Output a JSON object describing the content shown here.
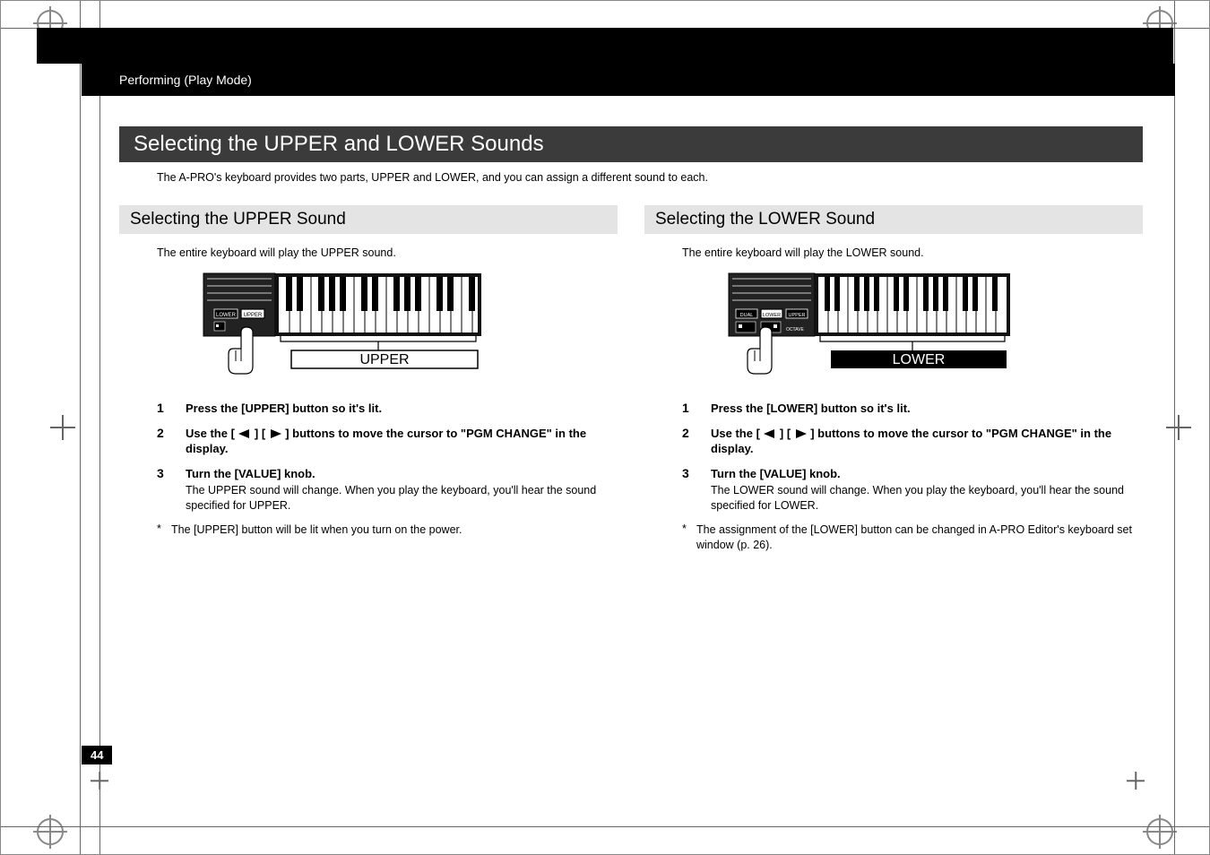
{
  "header": {
    "breadcrumb": "Performing (Play Mode)"
  },
  "title": "Selecting the UPPER and LOWER Sounds",
  "intro": "The A-PRO's keyboard provides two parts, UPPER and LOWER, and you can assign a different sound to each.",
  "upper": {
    "heading": "Selecting the UPPER Sound",
    "intro": "The entire keyboard will play the UPPER sound.",
    "diagram_label": "UPPER",
    "steps": [
      {
        "num": "1",
        "bold": "Press the [UPPER] button so it's lit."
      },
      {
        "num": "2",
        "bold_pre": "Use the [",
        "bold_mid": "] [",
        "bold_post": "] buttons to move the cursor to \"PGM CHANGE\" in the display."
      },
      {
        "num": "3",
        "bold": "Turn the [VALUE] knob.",
        "plain": "The UPPER sound will change. When you play the keyboard, you'll hear the sound specified for UPPER."
      }
    ],
    "note": "The [UPPER] button will be lit when you turn on the power."
  },
  "lower": {
    "heading": "Selecting the LOWER Sound",
    "intro": "The entire keyboard will play the LOWER sound.",
    "diagram_label": "LOWER",
    "steps": [
      {
        "num": "1",
        "bold": "Press the [LOWER] button so it's lit."
      },
      {
        "num": "2",
        "bold_pre": "Use the [",
        "bold_mid": "] [",
        "bold_post": "] buttons to move the cursor to \"PGM CHANGE\" in the display."
      },
      {
        "num": "3",
        "bold": "Turn the [VALUE] knob.",
        "plain": "The LOWER sound will change. When you play the keyboard, you'll hear the sound specified for LOWER."
      }
    ],
    "note": "The assignment of the [LOWER] button can be changed in A-PRO Editor's keyboard set window (p. 26)."
  },
  "page_number": "44",
  "note_marker": "*",
  "diagram_buttons": {
    "lower": "LOWER",
    "upper": "UPPER",
    "dual": "DUAL",
    "octave": "OCTAVE"
  }
}
